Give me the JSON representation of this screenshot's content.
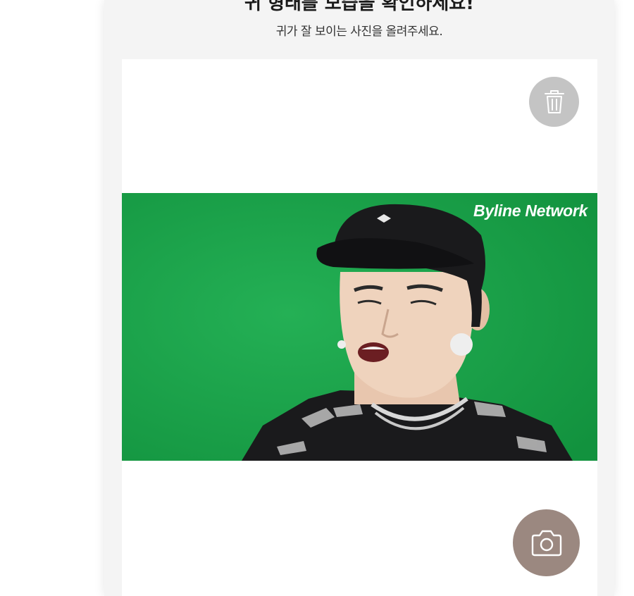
{
  "header": {
    "title": "귀 형태를 모습을 확인하세요!",
    "subtitle": "귀가 잘 보이는 사진을 올려주세요."
  },
  "upload": {
    "watermark": "Byline Network",
    "delete_icon": "trash-icon",
    "camera_icon": "camera-icon"
  },
  "colors": {
    "page_bg": "#f4f4f4",
    "card_bg": "#ffffff",
    "delete_button": "#c4c4c4",
    "camera_button": "#9b8880",
    "photo_background": "#1aa24a"
  }
}
